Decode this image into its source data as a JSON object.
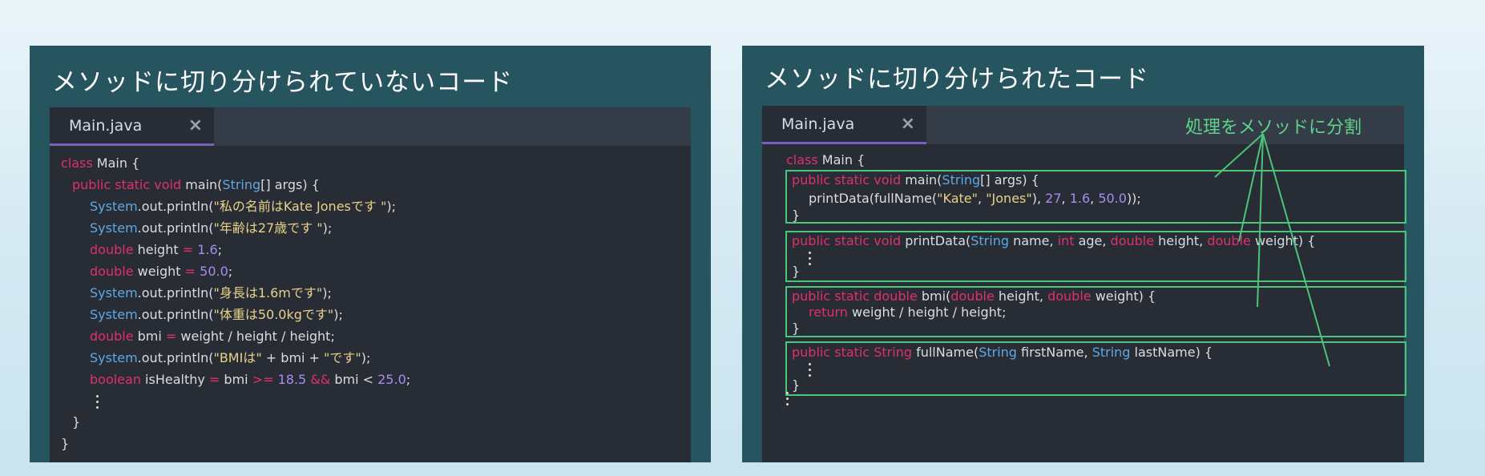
{
  "left_panel": {
    "title": "メソッドに切り分けられていないコード",
    "tab": {
      "name": "Main.java",
      "close": "×"
    },
    "code": {
      "class_kw": "class",
      "class_name": " Main {",
      "l2": {
        "kw": "public static void",
        "rest1": " main(",
        "ty": "String",
        "rest2": "[] args) {"
      },
      "l3": {
        "ty": "System",
        "rest": ".out.println(",
        "str": "\"私の名前はKate Jonesです \"",
        "end": ");"
      },
      "l4": {
        "ty": "System",
        "rest": ".out.println(",
        "str": "\"年齢は27歳です \"",
        "end": ");"
      },
      "l5": {
        "kw": "double",
        "rest": " height ",
        "op": "=",
        "num": " 1.6",
        "end": ";"
      },
      "l6": {
        "kw": "double",
        "rest": " weight ",
        "op": "=",
        "num": " 50.0",
        "end": ";"
      },
      "l7": {
        "ty": "System",
        "rest": ".out.println(",
        "str": "\"身長は1.6mです\"",
        "end": ");"
      },
      "l8": {
        "ty": "System",
        "rest": ".out.println(",
        "str": "\"体重は50.0kgです\"",
        "end": ");"
      },
      "l9": {
        "kw": "double",
        "rest": " bmi ",
        "op": "=",
        "rest2": " weight / height / height;"
      },
      "l10": {
        "ty": "System",
        "rest": ".out.println(",
        "str1": "\"BMIは\"",
        "mid": " + bmi + ",
        "str2": "\"です\"",
        "end": ");"
      },
      "l11": {
        "kw": "boolean",
        "rest": " isHealthy ",
        "op1": "=",
        "rest2": " bmi ",
        "op2": ">=",
        "num1": " 18.5 ",
        "op3": "&&",
        "rest3": " bmi < ",
        "num2": "25.0",
        "end": ";"
      },
      "close1": "}",
      "close2": "}"
    }
  },
  "right_panel": {
    "title": "メソッドに切り分けられたコード",
    "tab": {
      "name": "Main.java",
      "close": "×"
    },
    "annotation": "処理をメソッドに分割",
    "code": {
      "class_kw": "class",
      "class_name": " Main {",
      "m1": {
        "kw": "public static void",
        "rest1": " main(",
        "ty": "String",
        "rest2": "[] args) {",
        "body1": "printData(fullName(",
        "s1": "\"Kate\"",
        "c1": ", ",
        "s2": "\"Jones\"",
        "c2": "), ",
        "n1": "27",
        "c3": ", ",
        "n2": "1.6",
        "c4": ", ",
        "n3": "50.0",
        "end": "));",
        "close": "}"
      },
      "m2": {
        "kw": "public static void",
        "rest1": " printData(",
        "ty1": "String",
        "r2": " name, ",
        "kw2": "int",
        "r3": " age, ",
        "kw3": "double",
        "r4": " height, ",
        "kw4": "double",
        "r5": " weight) {",
        "close": "}"
      },
      "m3": {
        "kw": "public static double",
        "rest1": " bmi(",
        "kw2": "double",
        "r2": " height, ",
        "kw3": "double",
        "r3": " weight) {",
        "ret_kw": "return",
        "ret": " weight / height / height;",
        "close": "}"
      },
      "m4": {
        "kw": "public static",
        "ty0": " String",
        "rest1": " fullName(",
        "ty1": "String",
        "r2": " firstName, ",
        "ty2": "String",
        "r3": " lastName) {",
        "close": "}"
      }
    }
  },
  "colors": {
    "panel": "#27555f",
    "editor": "#282c34",
    "keyword": "#e0306b",
    "type": "#5fa8e4",
    "string": "#e8d28a",
    "number": "#a88cf0",
    "box": "#4cc47a"
  }
}
